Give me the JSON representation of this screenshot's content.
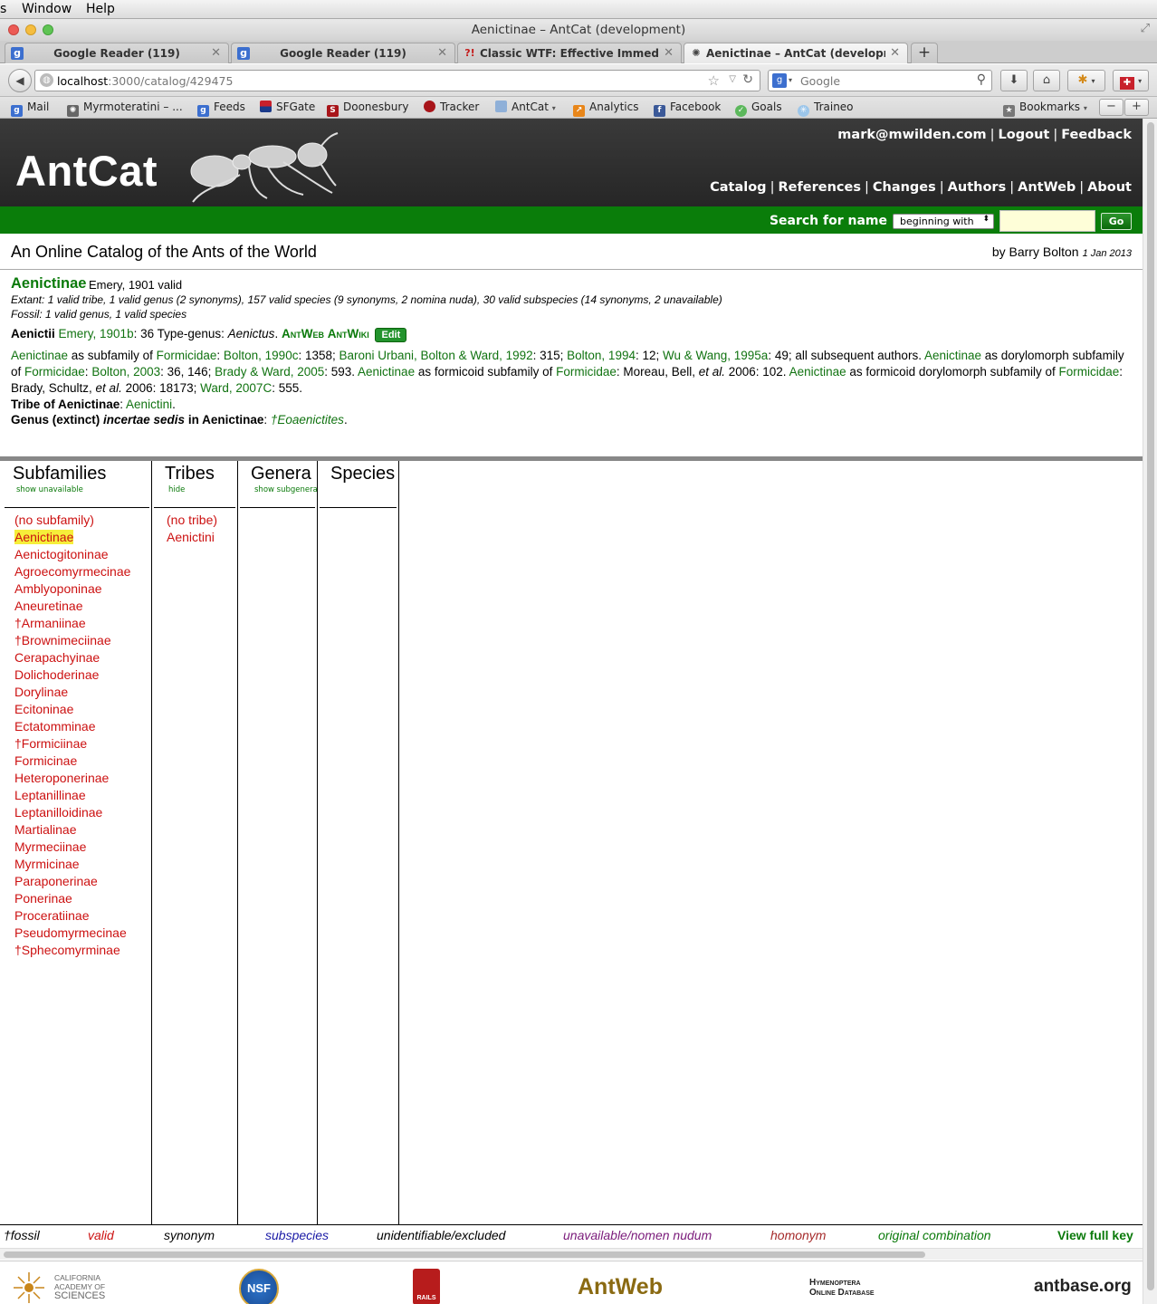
{
  "menubar": {
    "items": [
      "s",
      "Window",
      "Help"
    ]
  },
  "window": {
    "title": "Aenictinae – AntCat (development)"
  },
  "tabs": [
    {
      "label": "Google Reader (119)",
      "icon": "google-reader-icon"
    },
    {
      "label": "Google Reader (119)",
      "icon": "google-reader-icon"
    },
    {
      "label": "Classic WTF: Effective Immediat...",
      "icon": "wtf-icon"
    },
    {
      "label": "Aenictinae – AntCat (developme...",
      "icon": "antcat-icon"
    }
  ],
  "navbar": {
    "url_host": "localhost",
    "url_path": ":3000/catalog/429475",
    "search_placeholder": "Google"
  },
  "bookmarks": [
    {
      "label": "Mail",
      "icon": "google-icon"
    },
    {
      "label": "Myrmoteratini – ...",
      "icon": "ant-icon"
    },
    {
      "label": "Feeds",
      "icon": "feed-icon"
    },
    {
      "label": "SFGate",
      "icon": "sfgate-icon"
    },
    {
      "label": "Doonesbury",
      "icon": "slate-icon"
    },
    {
      "label": "Tracker",
      "icon": "tracker-icon"
    },
    {
      "label": "AntCat",
      "icon": "folder-icon"
    },
    {
      "label": "Analytics",
      "icon": "analytics-icon"
    },
    {
      "label": "Facebook",
      "icon": "facebook-icon"
    },
    {
      "label": "Goals",
      "icon": "goals-icon"
    },
    {
      "label": "Traineo",
      "icon": "traineo-icon"
    },
    {
      "label": "Bookmarks",
      "icon": "bookmarks-icon"
    }
  ],
  "header": {
    "logo": "AntCat",
    "user": "mark@mwilden.com",
    "logout": "Logout",
    "feedback": "Feedback",
    "nav": [
      "Catalog",
      "References",
      "Changes",
      "Authors",
      "AntWeb",
      "About"
    ]
  },
  "search": {
    "label": "Search for name",
    "mode": "beginning with",
    "go": "Go"
  },
  "site": {
    "title": "An Online Catalog of the Ants of the World",
    "byline": "by Barry Bolton",
    "date": "1 Jan 2013"
  },
  "taxon": {
    "name": "Aenictinae",
    "authorship": "Emery, 1901  valid",
    "extant": "Extant: 1 valid tribe, 1 valid genus (2 synonyms), 157 valid species (9 synonyms, 2 nomina nuda), 30 valid subspecies (14 synonyms, 2 unavailable)",
    "fossil": "Fossil: 1 valid genus, 1 valid species",
    "type_tribe": "Aenictii",
    "type_ref": "Emery, 1901b",
    "type_rest": ": 36 Type-genus: ",
    "type_genus": "Aenictus",
    "antweb": "AntWeb",
    "antwiki": "AntWiki",
    "edit": "Edit",
    "tribe_label": "Tribe of Aenictinae",
    "tribe_value": "Aenictini",
    "genus_label": "Genus (extinct) ",
    "genus_label_italic": "incertae sedis",
    "genus_label_tail": " in Aenictinae",
    "genus_value": "†Eoaenictites"
  },
  "columns": {
    "subfamilies": {
      "title": "Subfamilies",
      "sub": "show unavailable"
    },
    "tribes": {
      "title": "Tribes",
      "sub": "hide"
    },
    "genera": {
      "title": "Genera",
      "sub": "show subgenera"
    },
    "species": {
      "title": "Species"
    }
  },
  "subfamilies": [
    "(no subfamily)",
    "Aenictinae",
    "Aenictogitoninae",
    "Agroecomyrmecinae",
    "Amblyoponinae",
    "Aneuretinae",
    "†Armaniinae",
    "†Brownimeciinae",
    "Cerapachyinae",
    "Dolichoderinae",
    "Dorylinae",
    "Ecitoninae",
    "Ectatomminae",
    "†Formiciinae",
    "Formicinae",
    "Heteroponerinae",
    "Leptanillinae",
    "Leptanilloidinae",
    "Martialinae",
    "Myrmeciinae",
    "Myrmicinae",
    "Paraponerinae",
    "Ponerinae",
    "Proceratiinae",
    "Pseudomyrmecinae",
    "†Sphecomyrminae"
  ],
  "selected_subfamily": "Aenictinae",
  "tribes": [
    "(no tribe)",
    "Aenictini"
  ],
  "key": [
    {
      "label": "†fossil",
      "color": "#000000"
    },
    {
      "label": "valid",
      "color": "#cc1111"
    },
    {
      "label": "synonym",
      "color": "#000000"
    },
    {
      "label": "subspecies",
      "color": "#1a1aa6"
    },
    {
      "label": "unidentifiable/excluded",
      "color": "#000000"
    },
    {
      "label": "unavailable/nomen nudum",
      "color": "#7a1a7a"
    },
    {
      "label": "homonym",
      "color": "#a52a2a"
    },
    {
      "label": "original combination",
      "color": "#0b7a0b"
    },
    {
      "label": "View full key",
      "color": "#0b7a0b"
    }
  ],
  "footer": {
    "cas_lines": [
      "CALIFORNIA",
      "ACADEMY OF",
      "SCIENCES"
    ],
    "nsf": "NSF",
    "rails": "RAILS",
    "antweb": "AntWeb",
    "hol_lines": [
      "Hymenoptera",
      "Online Database"
    ],
    "antbase": "antbase.org"
  },
  "colors": {
    "green": "#0b7a0b",
    "valid_red": "#cc1111",
    "header_dark": "#2b2b2b",
    "highlight": "#f6ee3a"
  }
}
